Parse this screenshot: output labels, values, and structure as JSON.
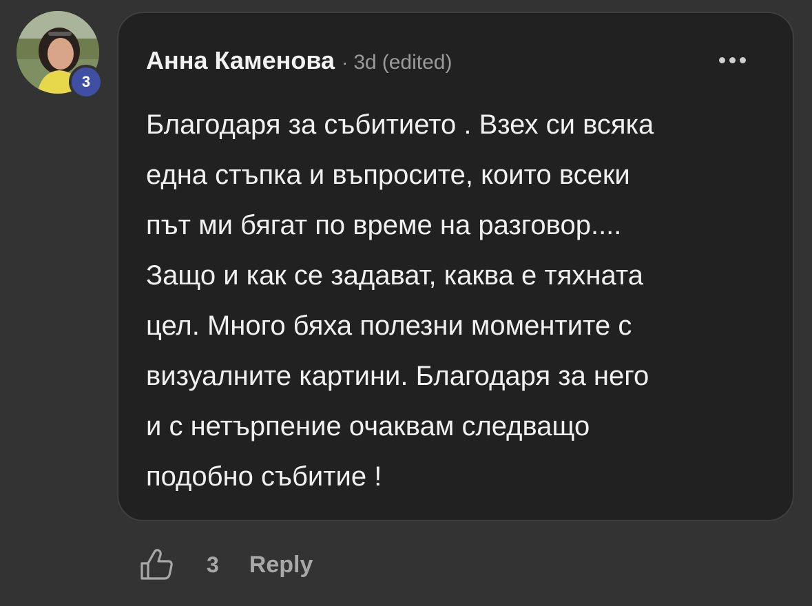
{
  "comment": {
    "author": "Анна Каменова",
    "separator": "·",
    "time": "3d",
    "edited": "(edited)",
    "author_level": "3",
    "body_lines": [
      "Благодаря за събитието . Взех си всяка",
      "една стъпка и въпросите, които всеки",
      "път ми бягат по време на разговор....",
      "Защо и как се задават, каква е тяхната",
      "цел. Много бяха полезни моментите с",
      "визуалните картини. Благодаря за него",
      "и с нетърпение очаквам следващо",
      "подобно събитие !"
    ]
  },
  "actions": {
    "like_count": "3",
    "reply_label": "Reply",
    "like_icon": "thumbs-up-icon",
    "more_icon": "more-horizontal-icon"
  },
  "colors": {
    "page_background": "#333333",
    "bubble_background": "#212121",
    "badge": "#3e4fa4"
  }
}
